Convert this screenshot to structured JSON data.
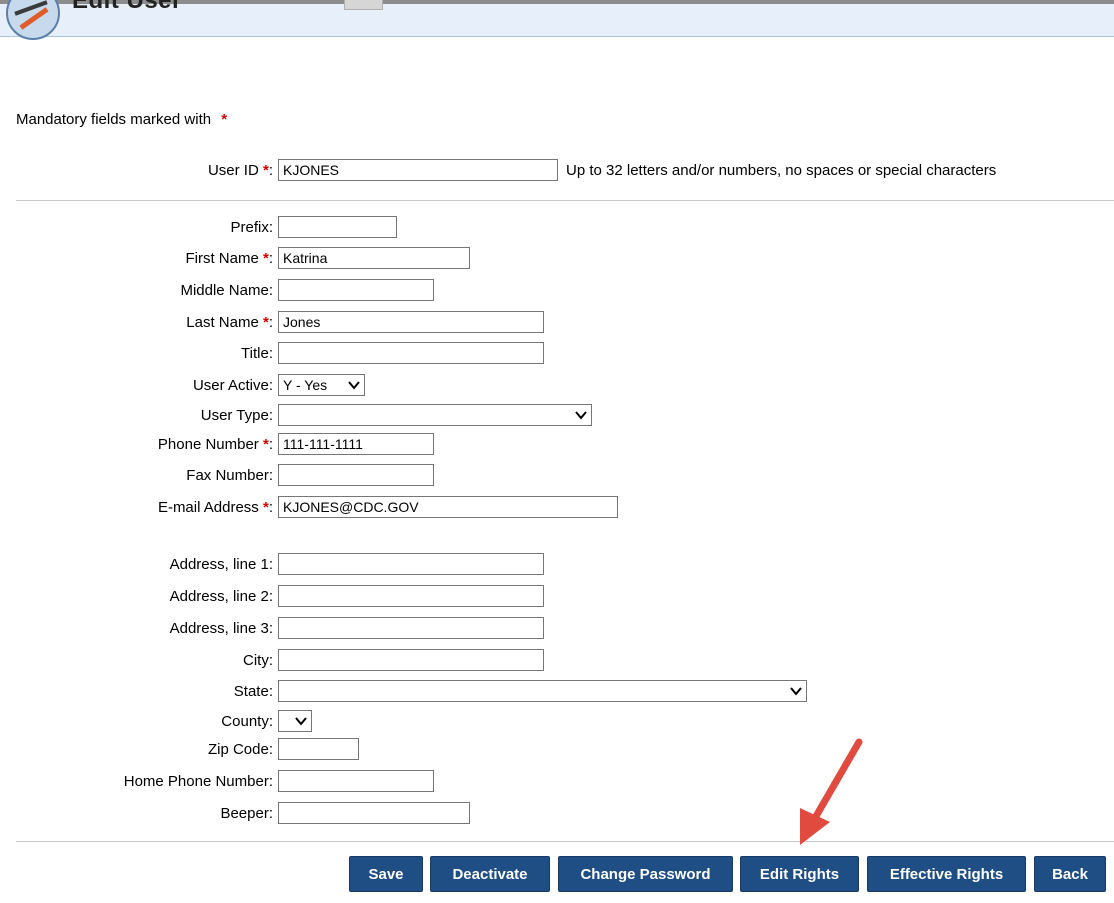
{
  "header": {
    "title": "Edit User"
  },
  "mandatory_note": {
    "text": "Mandatory fields marked with",
    "star": "*"
  },
  "user_id": {
    "label": "User ID",
    "value": "KJONES",
    "hint": "Up to 32 letters and/or numbers, no spaces or special characters"
  },
  "fields": {
    "prefix": {
      "label": "Prefix:",
      "value": ""
    },
    "first_name": {
      "label": "First Name",
      "value": "Katrina"
    },
    "middle_name": {
      "label": "Middle Name:",
      "value": ""
    },
    "last_name": {
      "label": "Last Name",
      "value": "Jones"
    },
    "title": {
      "label": "Title:",
      "value": ""
    },
    "user_active": {
      "label": "User Active:",
      "value": "Y - Yes"
    },
    "user_type": {
      "label": "User Type:",
      "value": ""
    },
    "phone": {
      "label": "Phone Number",
      "value": "111-111-1111"
    },
    "fax": {
      "label": "Fax Number:",
      "value": ""
    },
    "email": {
      "label": "E-mail Address",
      "value": "KJONES@CDC.GOV"
    },
    "address1": {
      "label": "Address, line 1:",
      "value": ""
    },
    "address2": {
      "label": "Address, line 2:",
      "value": ""
    },
    "address3": {
      "label": "Address, line 3:",
      "value": ""
    },
    "city": {
      "label": "City:",
      "value": ""
    },
    "state": {
      "label": "State:",
      "value": ""
    },
    "county": {
      "label": "County:",
      "value": ""
    },
    "zip": {
      "label": "Zip Code:",
      "value": ""
    },
    "home_phone": {
      "label": "Home Phone Number:",
      "value": ""
    },
    "beeper": {
      "label": "Beeper:",
      "value": ""
    }
  },
  "required_suffix": ":",
  "buttons": {
    "save": "Save",
    "deactivate": "Deactivate",
    "change_password": "Change Password",
    "edit_rights": "Edit Rights",
    "effective_rights": "Effective Rights",
    "back": "Back"
  },
  "colors": {
    "button_bg": "#1f4e85",
    "required_star": "#d00000",
    "arrow": "#e04a3f",
    "header_bg": "#e7f0fa"
  }
}
